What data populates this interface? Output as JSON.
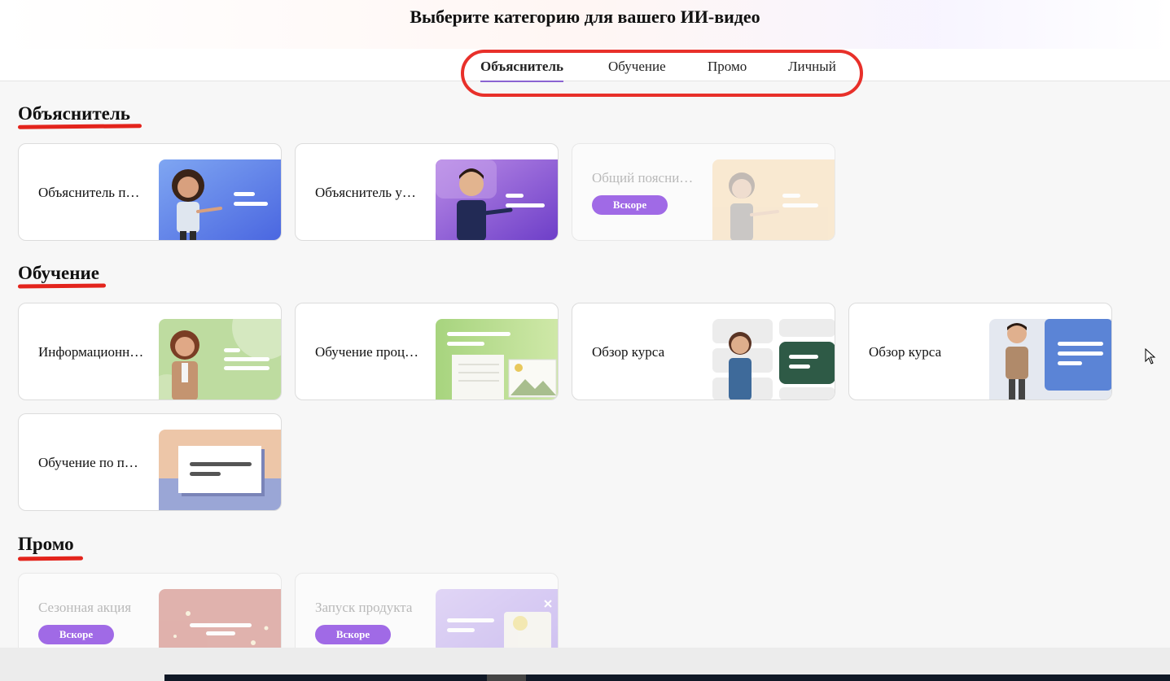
{
  "header": {
    "title": "Выберите категорию для вашего ИИ-видео",
    "tabs": [
      {
        "label": "Объяснитель",
        "active": true
      },
      {
        "label": "Обучение",
        "active": false
      },
      {
        "label": "Промо",
        "active": false
      },
      {
        "label": "Личный",
        "active": false
      }
    ]
  },
  "sections": {
    "explainer": {
      "title": "Объяснитель",
      "cards": [
        {
          "label": "Объяснитель п…",
          "badge": null,
          "thumb": "woman-presenter-blue"
        },
        {
          "label": "Объяснитель у…",
          "badge": null,
          "thumb": "man-presenter-purple"
        },
        {
          "label": "Общий поясни…",
          "badge": "Вскоре",
          "thumb": "woman-presenter-peach"
        }
      ]
    },
    "training": {
      "title": "Обучение",
      "cards": [
        {
          "label": "Информационн…",
          "badge": null,
          "thumb": "woman-green"
        },
        {
          "label": "Обучение проц…",
          "badge": null,
          "thumb": "document-green"
        },
        {
          "label": "Обзор курса",
          "badge": null,
          "thumb": "woman-glasses-grid"
        },
        {
          "label": "Обзор курса",
          "badge": null,
          "thumb": "man-blue-board"
        },
        {
          "label": "Обучение по п…",
          "badge": null,
          "thumb": "slide-beige-blue"
        }
      ]
    },
    "promo": {
      "title": "Промо",
      "cards": [
        {
          "label": "Сезонная акция",
          "badge": "Вскоре",
          "thumb": "pink-sparkles"
        },
        {
          "label": "Запуск продукта",
          "badge": "Вскоре",
          "thumb": "lavender-image"
        }
      ]
    }
  },
  "colors": {
    "accent": "#8a63d2",
    "badge": "#a06ae6",
    "highlight_red": "#e3241c"
  }
}
